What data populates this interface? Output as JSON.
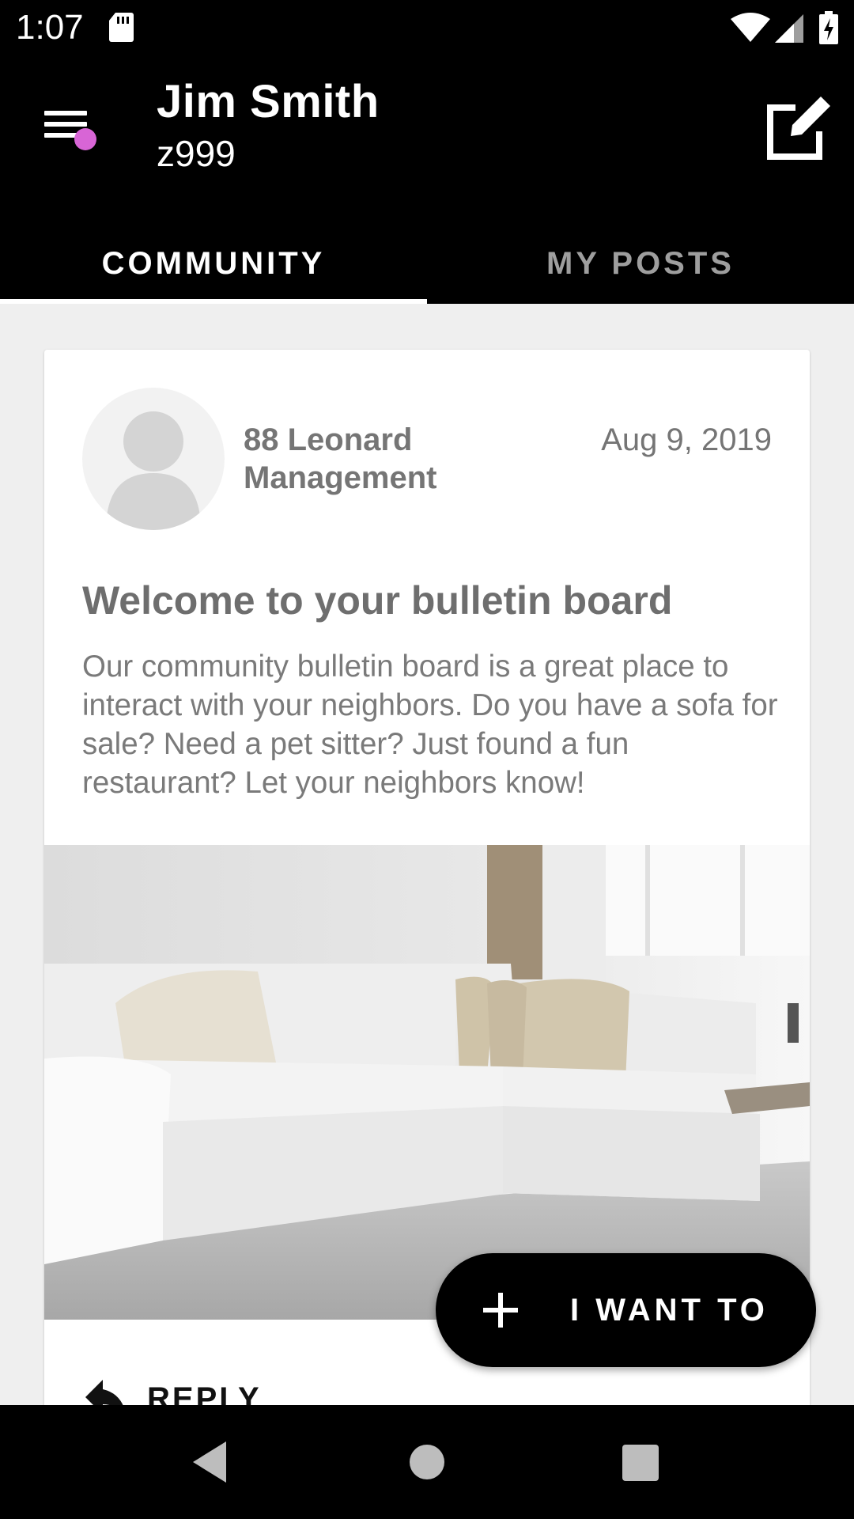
{
  "status_bar": {
    "time": "1:07",
    "icons": [
      "sd-card-icon",
      "wifi-icon",
      "cell-signal-icon",
      "battery-charging-icon"
    ]
  },
  "header": {
    "user_name": "Jim Smith",
    "unit": "z999",
    "menu_icon": "hamburger-menu-icon",
    "notification_dot_color": "#d865d6",
    "compose_icon": "edit-post-icon"
  },
  "tabs": [
    {
      "label": "COMMUNITY",
      "selected": true
    },
    {
      "label": "MY POSTS",
      "selected": false
    }
  ],
  "post": {
    "author": "88 Leonard Management",
    "date": "Aug 9, 2019",
    "title": "Welcome to your bulletin board",
    "body": "Our community bulletin board is a great place to interact with your neighbors.  Do you have a sofa for sale?  Need a pet sitter?  Just found a fun restaurant?  Let your neighbors know!",
    "image_subject": "white sectional sofa in a bright living room",
    "reply_label": "REPLY"
  },
  "fab": {
    "label": "I WANT TO",
    "icon": "plus-icon"
  },
  "nav_bar": {
    "icons": [
      "back-icon",
      "home-icon",
      "recents-icon"
    ]
  },
  "colors": {
    "app_bar": "#000000",
    "background": "#efefef",
    "accent_dot": "#d865d6"
  }
}
